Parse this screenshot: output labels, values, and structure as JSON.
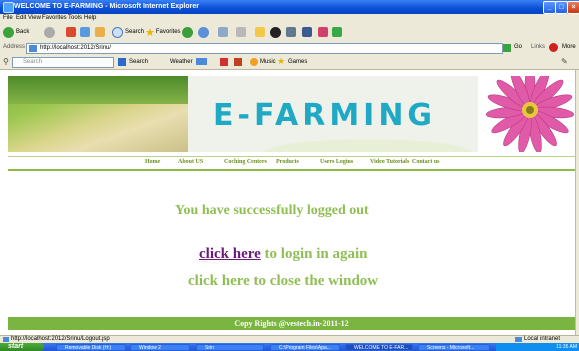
{
  "window": {
    "title": "WELCOME TO E-FARMING - Microsoft Internet Explorer"
  },
  "menu": [
    "File",
    "Edit",
    "View",
    "Favorites",
    "Tools",
    "Help"
  ],
  "toolbar": {
    "back": "Back",
    "search": "Search",
    "favorites": "Favorites"
  },
  "address": {
    "label": "Address",
    "url": "http://localhost:2012/Srinu/",
    "go": "Go",
    "links": "Links",
    "more": "More"
  },
  "searchbar": {
    "placeholder": "Search",
    "search_btn": "Search",
    "weather": "Weather",
    "music": "Music",
    "games": "Games"
  },
  "page": {
    "banner_title": "E-FARMING",
    "nav": [
      "Home",
      "About US",
      "Coching Centers",
      "Products",
      "Users Logins",
      "Video Tutorials",
      "Contact us"
    ],
    "message": "You have successfully logged out",
    "login_link": "click here",
    "login_rest": " to login in again",
    "close_text": "click here to close the window",
    "footer": "Copy Rights @vestech.in-2011-12"
  },
  "status": {
    "url": "http://localhost:2012/Srinu/Logout.jsp",
    "zone": "Local intranet"
  },
  "taskbar": {
    "start": "start",
    "tasks": [
      "Removable Disk (H:)",
      "Window 2",
      "Srin",
      "C:\\Program Files\\Apa...",
      "WELCOME TO E-FAR...",
      "Screens - Microsoft..."
    ],
    "clock": "11:35 AM"
  }
}
